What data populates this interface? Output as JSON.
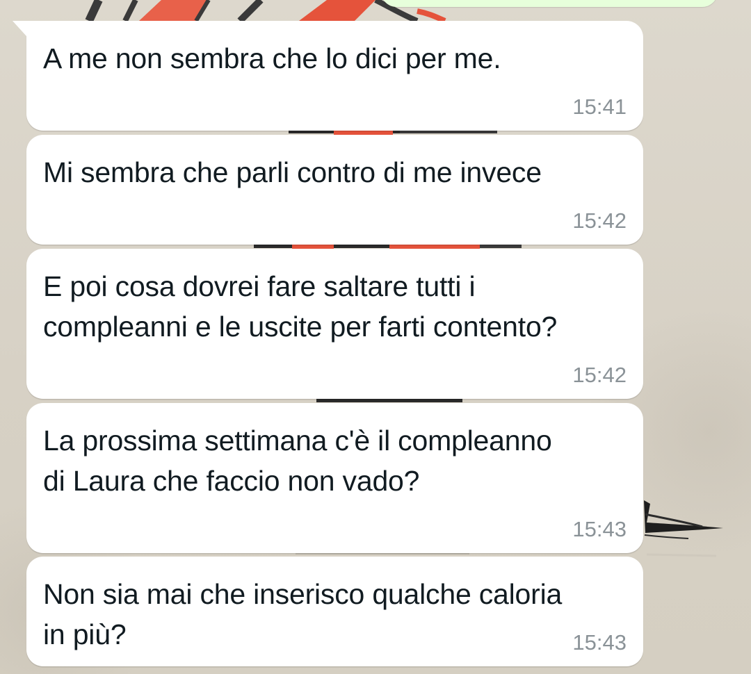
{
  "conversation": {
    "messages": [
      {
        "text": "A me non sembra che lo dici per me.",
        "time": "15:41"
      },
      {
        "text": "Mi sembra che parli contro di me invece",
        "time": "15:42"
      },
      {
        "text": "E poi cosa dovrei fare saltare tutti i compleanni e le uscite per farti contento?",
        "time": "15:42"
      },
      {
        "text": "La prossima settimana c'è il compleanno di Laura che faccio non vado?",
        "time": "15:43"
      },
      {
        "text": "Non sia mai che inserisco qualche caloria in più?",
        "time": "15:43"
      }
    ]
  },
  "colors": {
    "received_bubble": "#ffffff",
    "sent_bubble": "#e7ffdb",
    "wallpaper": "#d9d4c9",
    "text": "#111b21",
    "timestamp": "#8a9297",
    "wallpaper_accent": "#e5533b"
  }
}
